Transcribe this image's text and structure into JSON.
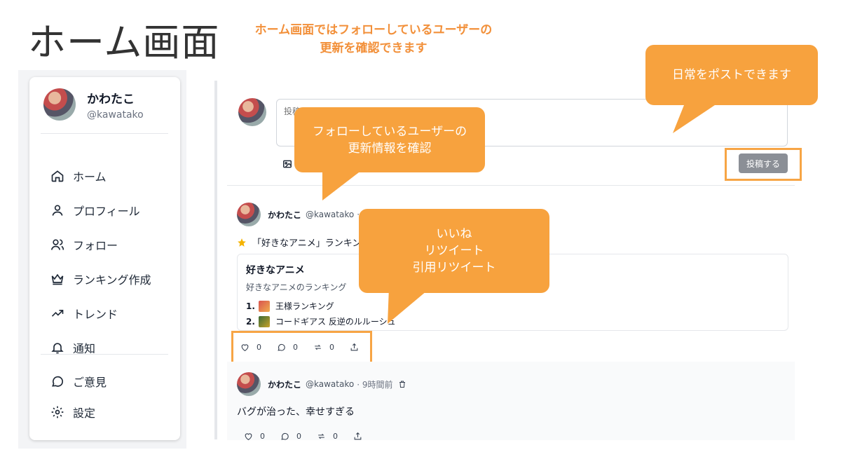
{
  "page": {
    "title": "ホーム画面",
    "header_note": [
      "ホーム画面ではフォローしているユーザーの",
      "更新を確認できます"
    ]
  },
  "sidebar": {
    "profile": {
      "name": "かわたこ",
      "handle": "@kawatako"
    },
    "items": [
      {
        "label": "ホーム",
        "icon": "home-icon"
      },
      {
        "label": "プロフィール",
        "icon": "user-icon"
      },
      {
        "label": "フォロー",
        "icon": "users-icon"
      },
      {
        "label": "ランキング作成",
        "icon": "crown-icon"
      },
      {
        "label": "トレンド",
        "icon": "trend-icon"
      },
      {
        "label": "通知",
        "icon": "bell-icon"
      }
    ],
    "secondary_items": [
      {
        "label": "ご意見",
        "icon": "chat-icon"
      },
      {
        "label": "設定",
        "icon": "gear-icon"
      }
    ]
  },
  "composer": {
    "placeholder": "投稿してみよう",
    "post_button": "投稿する"
  },
  "feed": {
    "post1": {
      "name": "かわたこ",
      "handle": "@kawatako",
      "meta": "·",
      "headline": "「好きなアニメ」ランキング",
      "card": {
        "title": "好きなアニメ",
        "description": "好きなアニメのランキング",
        "items": [
          {
            "rank": "1.",
            "label": "王様ランキング"
          },
          {
            "rank": "2.",
            "label": "コードギアス 反逆のルルーシュ"
          }
        ]
      },
      "actions": {
        "likes": "0",
        "replies": "0",
        "retweets": "0"
      }
    },
    "post2": {
      "name": "かわたこ",
      "handle": "@kawatako",
      "meta": "· 9時間前",
      "text": "バグが治った、幸せすぎる",
      "actions": {
        "likes": "0",
        "replies": "0",
        "retweets": "0"
      }
    }
  },
  "callouts": {
    "post": [
      "日常をポストできます"
    ],
    "follow": [
      "フォローしているユーザーの",
      "更新情報を確認"
    ],
    "actions": [
      "いいね",
      "リツイート",
      "引用リツイート"
    ]
  },
  "colors": {
    "accent": "#f7a23e",
    "header_note": "#f2903a",
    "button": "#8b8f96"
  }
}
